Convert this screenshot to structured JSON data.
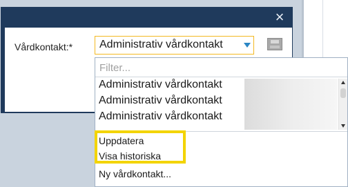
{
  "dialog": {
    "close_symbol": "×",
    "field_label": "Vårdkontakt:*",
    "select_value": "Administrativ vårdkontakt",
    "accent_color": "#1f3a5c"
  },
  "dropdown": {
    "filter_placeholder": "Filter...",
    "options": [
      "Administrativ vårdkontakt",
      "Administrativ vårdkontakt",
      "Administrativ vårdkontakt"
    ],
    "actions": {
      "update": "Uppdatera",
      "show_historic": "Visa historiska",
      "new_contact": "Ny vårdkontakt..."
    },
    "highlight_color": "#f3d400"
  },
  "icons": {
    "close": "close-icon",
    "dropdown_arrow": "chevron-down-icon",
    "save": "save-icon"
  }
}
